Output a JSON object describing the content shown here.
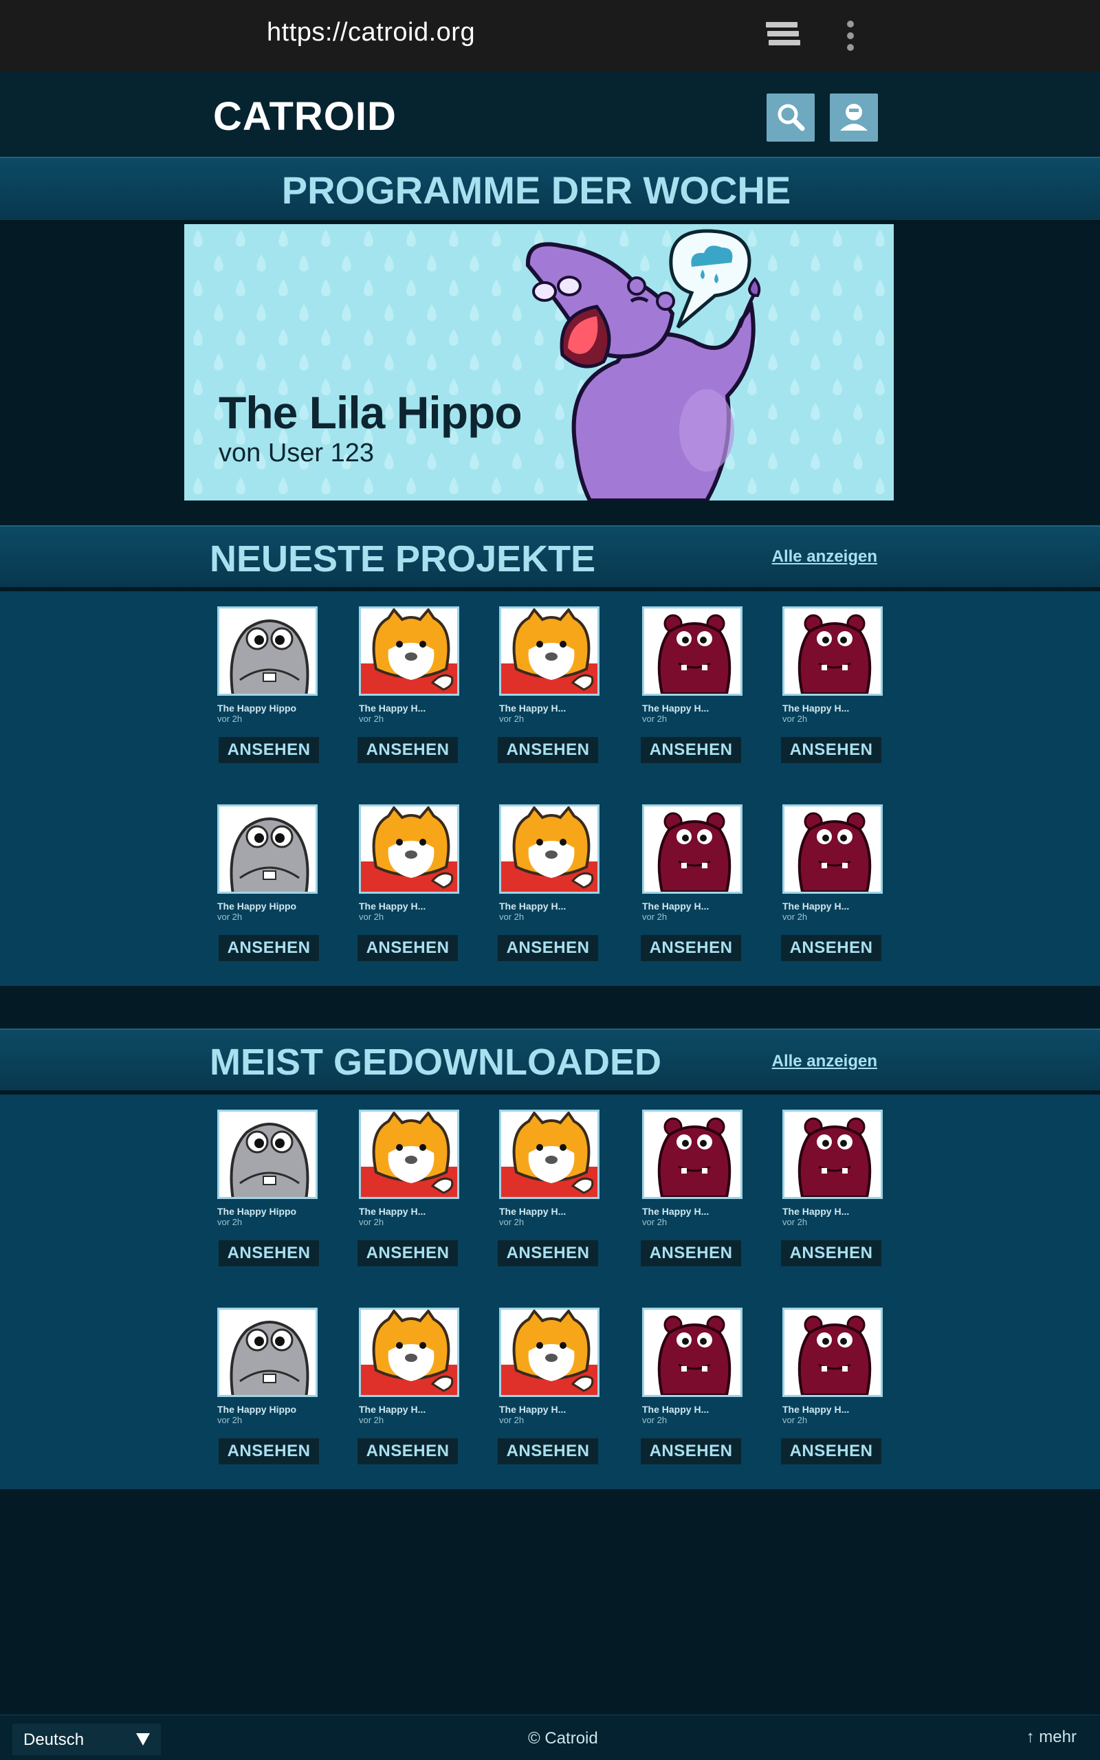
{
  "browser": {
    "url": "https://catroid.org"
  },
  "header": {
    "logo": "CATROID"
  },
  "featured": {
    "section_title": "PROGRAMME DER WOCHE",
    "title": "The Lila Hippo",
    "author": "von User 123"
  },
  "newest": {
    "title": "NEUESTE PROJEKTE",
    "show_all": "Alle anzeigen",
    "projects": [
      {
        "name": "The Happy Hippo",
        "time": "vor 2h",
        "button": "ANSEHEN",
        "thumb": "grey-hippo"
      },
      {
        "name": "The Happy H...",
        "time": "vor 2h",
        "button": "ANSEHEN",
        "thumb": "tiger"
      },
      {
        "name": "The Happy H...",
        "time": "vor 2h",
        "button": "ANSEHEN",
        "thumb": "tiger"
      },
      {
        "name": "The Happy H...",
        "time": "vor 2h",
        "button": "ANSEHEN",
        "thumb": "red-hippo"
      },
      {
        "name": "The Happy H...",
        "time": "vor 2h",
        "button": "ANSEHEN",
        "thumb": "red-hippo"
      },
      {
        "name": "The Happy Hippo",
        "time": "vor 2h",
        "button": "ANSEHEN",
        "thumb": "grey-hippo"
      },
      {
        "name": "The Happy H...",
        "time": "vor 2h",
        "button": "ANSEHEN",
        "thumb": "tiger"
      },
      {
        "name": "The Happy H...",
        "time": "vor 2h",
        "button": "ANSEHEN",
        "thumb": "tiger"
      },
      {
        "name": "The Happy H...",
        "time": "vor 2h",
        "button": "ANSEHEN",
        "thumb": "red-hippo"
      },
      {
        "name": "The Happy H...",
        "time": "vor 2h",
        "button": "ANSEHEN",
        "thumb": "red-hippo"
      }
    ]
  },
  "most_downloaded": {
    "title": "MEIST GEDOWNLOADED",
    "show_all": "Alle anzeigen",
    "projects": [
      {
        "name": "The Happy Hippo",
        "time": "vor 2h",
        "button": "ANSEHEN",
        "thumb": "grey-hippo"
      },
      {
        "name": "The Happy H...",
        "time": "vor 2h",
        "button": "ANSEHEN",
        "thumb": "tiger"
      },
      {
        "name": "The Happy H...",
        "time": "vor 2h",
        "button": "ANSEHEN",
        "thumb": "tiger"
      },
      {
        "name": "The Happy H...",
        "time": "vor 2h",
        "button": "ANSEHEN",
        "thumb": "red-hippo"
      },
      {
        "name": "The Happy H...",
        "time": "vor 2h",
        "button": "ANSEHEN",
        "thumb": "red-hippo"
      },
      {
        "name": "The Happy Hippo",
        "time": "vor 2h",
        "button": "ANSEHEN",
        "thumb": "grey-hippo"
      },
      {
        "name": "The Happy H...",
        "time": "vor 2h",
        "button": "ANSEHEN",
        "thumb": "tiger"
      },
      {
        "name": "The Happy H...",
        "time": "vor 2h",
        "button": "ANSEHEN",
        "thumb": "tiger"
      },
      {
        "name": "The Happy H...",
        "time": "vor 2h",
        "button": "ANSEHEN",
        "thumb": "red-hippo"
      },
      {
        "name": "The Happy H...",
        "time": "vor 2h",
        "button": "ANSEHEN",
        "thumb": "red-hippo"
      }
    ]
  },
  "footer": {
    "language": "Deutsch",
    "copyright": "© Catroid",
    "more": "↑ mehr"
  },
  "icons": {
    "tabs": "tabs-icon",
    "menu": "more-vertical-icon",
    "search": "search-icon",
    "profile": "user-icon",
    "language": "chevron-down-icon"
  }
}
